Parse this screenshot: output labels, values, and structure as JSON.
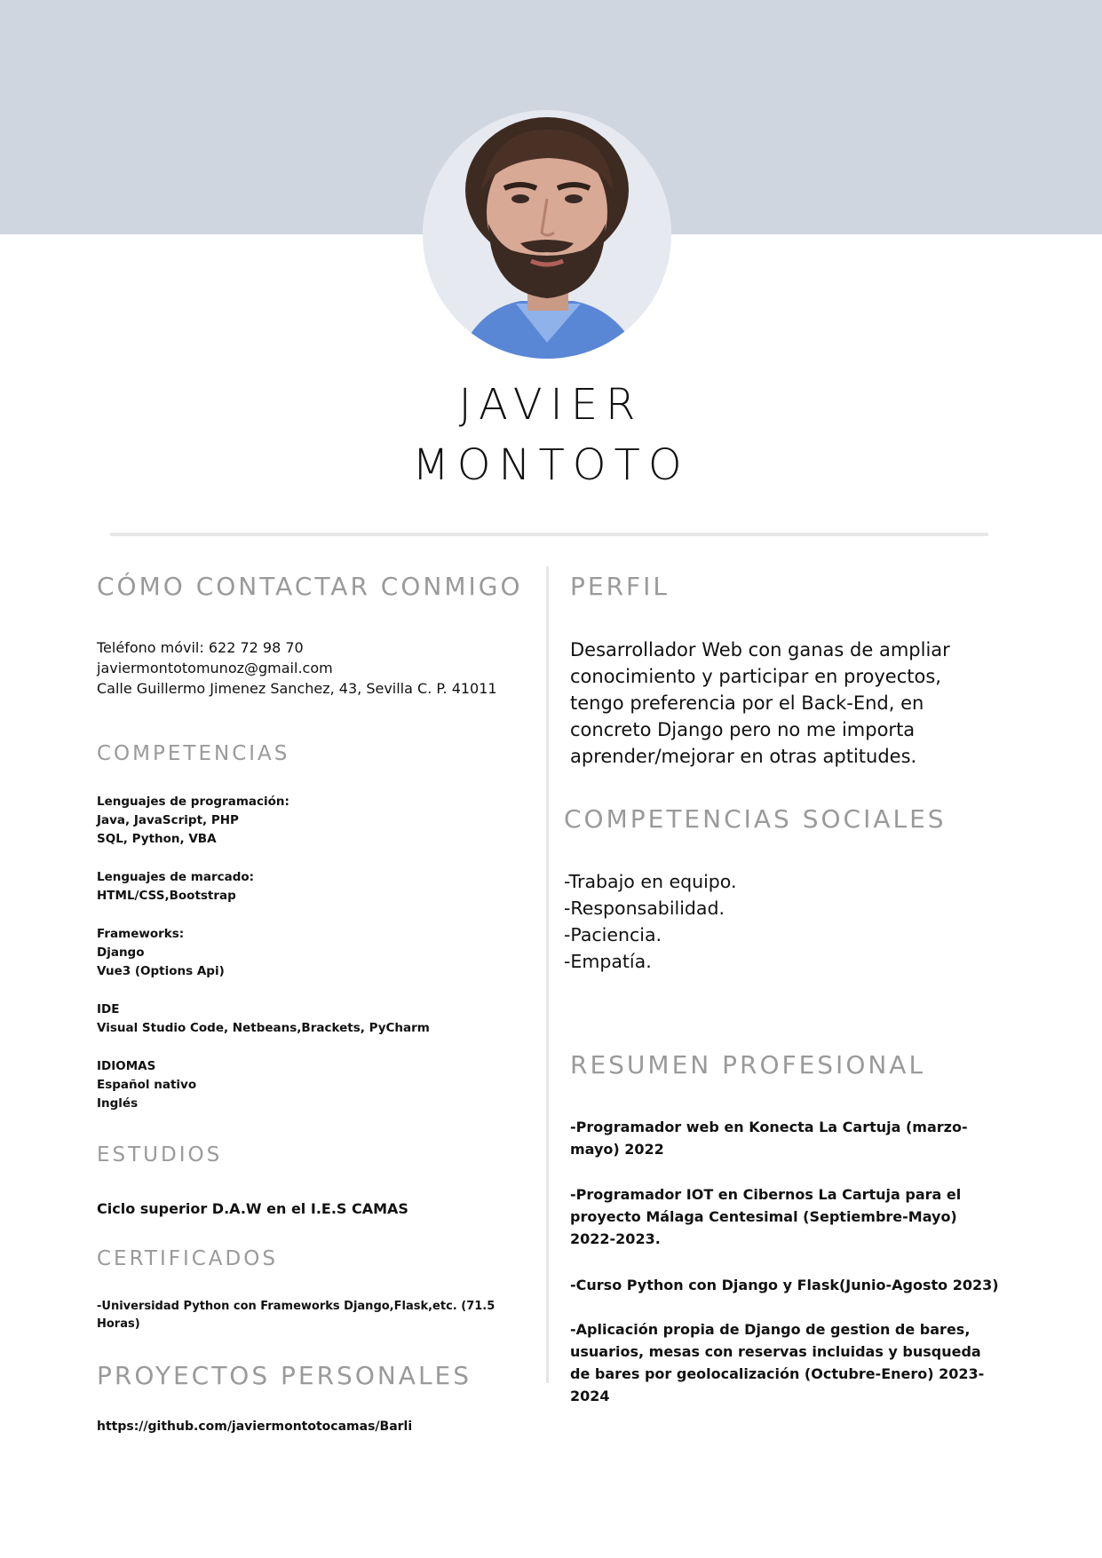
{
  "header": {
    "first_name": "JAVIER",
    "last_name": "MONTOTO",
    "photo_icon": "profile-photo"
  },
  "contact": {
    "heading": "CÓMO CONTACTAR CONMIGO",
    "phone": "Teléfono móvil: 622 72 98 70",
    "email": "javiermontotomunoz@gmail.com",
    "address": "Calle Guillermo Jimenez Sanchez, 43, Sevilla C. P. 41011"
  },
  "skills": {
    "heading": "COMPETENCIAS",
    "groups": [
      {
        "title": "Lenguajes de programación:",
        "lines": [
          "Java, JavaScript, PHP",
          "SQL, Python, VBA"
        ]
      },
      {
        "title": "Lenguajes de marcado:",
        "lines": [
          "HTML/CSS,Bootstrap"
        ]
      },
      {
        "title": "Frameworks:",
        "lines": [
          "Django",
          "Vue3 (Options Api)"
        ]
      },
      {
        "title": "IDE",
        "lines": [
          "Visual Studio Code, Netbeans,Brackets, PyCharm"
        ]
      },
      {
        "title": "IDIOMAS",
        "lines": [
          "Español nativo",
          "Inglés"
        ]
      }
    ]
  },
  "studies": {
    "heading": "ESTUDIOS",
    "item": "Ciclo superior D.A.W  en el I.E.S CAMAS"
  },
  "certificates": {
    "heading": "CERTIFICADOS",
    "lines": [
      "-Universidad Python con Frameworks Django,Flask,etc. (71.5",
      "Horas)"
    ]
  },
  "projects": {
    "heading": "PROYECTOS PERSONALES",
    "link": "https://github.com/javiermontotocamas/Barli"
  },
  "profile": {
    "heading": "PERFIL",
    "text": "Desarrollador Web con ganas de ampliar conocimiento y participar en proyectos, tengo preferencia por el Back-End, en concreto Django pero no me importa aprender/mejorar en otras aptitudes."
  },
  "social": {
    "heading": "COMPETENCIAS SOCIALES",
    "items": [
      "-Trabajo en equipo.",
      "-Responsabilidad.",
      "-Paciencia.",
      "-Empatía."
    ]
  },
  "summary": {
    "heading": "RESUMEN PROFESIONAL",
    "items": [
      "-Programador web en Konecta La Cartuja (marzo-mayo) 2022",
      "-Programador IOT en Cibernos La Cartuja para el proyecto Málaga Centesimal (Septiembre-Mayo) 2022-2023.",
      "-Curso Python con Django y Flask(Junio-Agosto 2023)",
      "-Aplicación propia de Django de gestion de bares, usuarios, mesas con reservas incluidas y busqueda de bares por geolocalización (Octubre-Enero) 2023-2024"
    ]
  }
}
